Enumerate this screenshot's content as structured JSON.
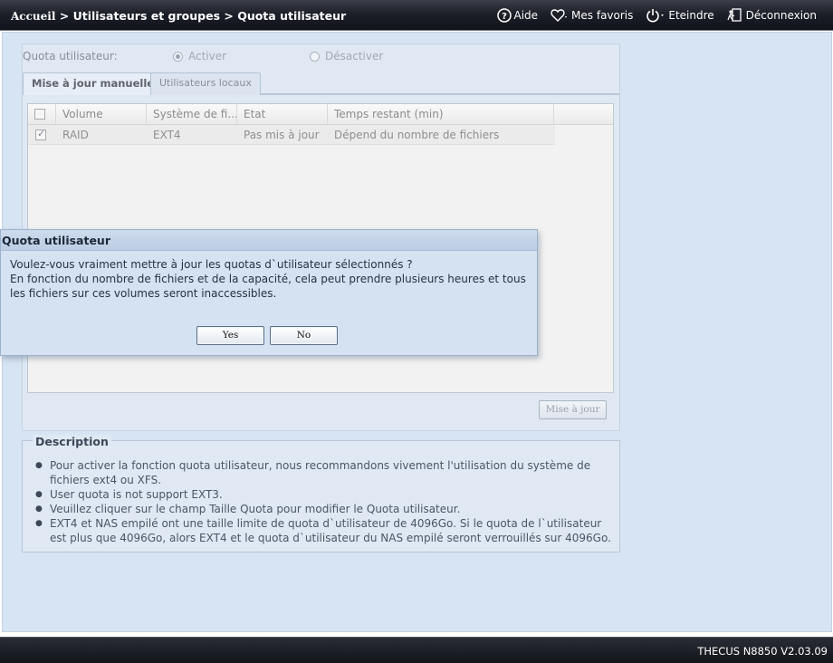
{
  "header": {
    "breadcrumb_home": "Accueil",
    "breadcrumb_rest": " > Utilisateurs et groupes > Quota utilisateur",
    "nav": {
      "help": "Aide",
      "favorites": "Mes favoris",
      "shutdown": "Eteindre",
      "logout": "Déconnexion"
    }
  },
  "quota": {
    "label": "Quota utilisateur:",
    "enable": "Activer",
    "disable": "Désactiver",
    "selected": "enable"
  },
  "tabs": [
    {
      "label": "Mise à jour manuelle",
      "active": true
    },
    {
      "label": "Utilisateurs locaux",
      "active": false
    }
  ],
  "table": {
    "columns": [
      "Volume",
      "Système de fi...",
      "Etat",
      "Temps restant (min)"
    ],
    "rows": [
      {
        "checked": true,
        "cells": [
          "RAID",
          "EXT4",
          "Pas mis à jour",
          "Dépend du nombre de fichiers"
        ]
      }
    ],
    "update_button": "Mise à jour"
  },
  "description": {
    "title": "Description",
    "items": [
      "Pour activer la fonction quota utilisateur, nous recommandons vivement l'utilisation du système de fichiers ext4 ou XFS.",
      "User quota is not support EXT3.",
      "Veuillez cliquer sur le champ Taille Quota pour modifier le Quota utilisateur.",
      "EXT4 et NAS empilé ont une taille limite de quota d`utilisateur de 4096Go. Si le quota de l`utilisateur est plus que 4096Go, alors EXT4 et le quota d`utilisateur du NAS empilé seront verrouillés sur 4096Go."
    ]
  },
  "dialog": {
    "title": "Quota utilisateur",
    "line1": "Voulez-vous vraiment mettre à jour les quotas d`utilisateur sélectionnés ?",
    "line2": "En fonction du nombre de fichiers et de la capacité, cela peut prendre plusieurs heures et tous les fichiers sur ces volumes seront inaccessibles.",
    "yes": "Yes",
    "no": "No"
  },
  "footer": {
    "version": "THECUS N8850 V2.03.09"
  }
}
